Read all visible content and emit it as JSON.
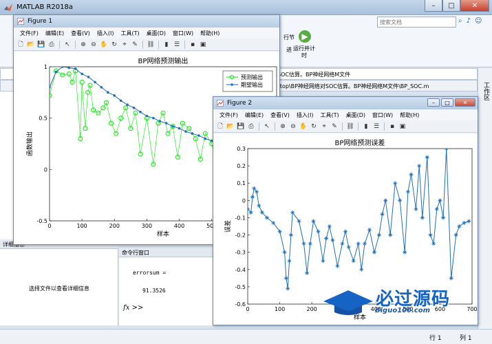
{
  "main": {
    "title": "MATLAB R2018a",
    "search_placeholder": "搜索文档",
    "ribbon_btn1": "行节",
    "ribbon_btn2": "进",
    "ribbon_run": "运行并计时",
    "path": "SOC估算。BP神经网络M文件",
    "editor_path": "sktop\\BP神经网络对SOC估算。BP神经网络M文件\\BP_SOC.m",
    "side_label": "工作区",
    "detail_header": "详细信息",
    "detail_msg": "选择文件以查看详细信息",
    "cmd_header": "命令行窗口",
    "cmd_line1": "errorsum =",
    "cmd_line2": "91.3526",
    "cmd_prompt": "fx >>",
    "status_row_label": "行",
    "status_row": "1",
    "status_col_label": "列",
    "status_col": "1",
    "accent": "#1f63b7"
  },
  "menu": [
    "文件(F)",
    "编辑(E)",
    "查看(V)",
    "插入(I)",
    "工具(T)",
    "桌面(D)",
    "窗口(W)",
    "帮助(H)"
  ],
  "figure1": {
    "title": "Figure 1",
    "chart_data": {
      "type": "line",
      "title": "BP网络预测输出",
      "xlabel": "样本",
      "ylabel": "函数输出",
      "xlim": [
        0,
        700
      ],
      "ylim": [
        -0.5,
        1
      ],
      "xticks": [
        0,
        100,
        200,
        300,
        400,
        500,
        600
      ],
      "yticks": [
        -0.5,
        0,
        0.5,
        1
      ],
      "legend": "top-right",
      "series": [
        {
          "name": "预测输出",
          "color": "#00ee00",
          "marker": "circle",
          "x": [
            0,
            20,
            40,
            60,
            70,
            80,
            95,
            100,
            110,
            118,
            125,
            135,
            150,
            165,
            175,
            190,
            205,
            220,
            235,
            250,
            265,
            280,
            300,
            320,
            335,
            350,
            365,
            380,
            395,
            410,
            430,
            450,
            465,
            480,
            500,
            515,
            530,
            550,
            565,
            580,
            600,
            620,
            640,
            660
          ],
          "y": [
            0.72,
            0.96,
            0.92,
            0.93,
            0.85,
            0.96,
            0.3,
            0.85,
            0.4,
            0.75,
            0.82,
            0.58,
            0.55,
            0.6,
            0.65,
            0.45,
            0.35,
            0.5,
            0.6,
            0.4,
            0.55,
            0.15,
            0.5,
            0.05,
            0.45,
            0.55,
            0.35,
            0.42,
            0.12,
            0.45,
            0.4,
            0.3,
            0.1,
            0.35,
            0.25,
            0.05,
            0.3,
            0.1,
            -0.05,
            0.2,
            0.05,
            0.25,
            0.1,
            0.2
          ]
        },
        {
          "name": "期望输出",
          "color": "#1f6fb8",
          "marker": "dot",
          "x": [
            0,
            20,
            40,
            60,
            80,
            100,
            120,
            140,
            160,
            180,
            200,
            220,
            240,
            260,
            280,
            300,
            320,
            340,
            360,
            380,
            400,
            420,
            440,
            460,
            480,
            500,
            520,
            540,
            560,
            580,
            600,
            620,
            640,
            660
          ],
          "y": [
            0.8,
            0.95,
            1.0,
            0.99,
            0.98,
            0.93,
            0.9,
            0.85,
            0.8,
            0.75,
            0.72,
            0.67,
            0.63,
            0.6,
            0.56,
            0.52,
            0.5,
            0.47,
            0.45,
            0.42,
            0.4,
            0.37,
            0.35,
            0.33,
            0.3,
            0.28,
            0.26,
            0.24,
            0.22,
            0.2,
            0.2,
            0.2,
            0.18,
            0.18
          ]
        }
      ]
    }
  },
  "figure2": {
    "title": "Figure 2",
    "chart_data": {
      "type": "line",
      "title": "BP网络预测误差",
      "xlabel": "样本",
      "ylabel": "误差",
      "xlim": [
        0,
        700
      ],
      "ylim": [
        -0.6,
        0.3
      ],
      "xticks": [
        0,
        100,
        200,
        300,
        400,
        500,
        600,
        700
      ],
      "yticks": [
        -0.6,
        -0.5,
        -0.4,
        -0.3,
        -0.2,
        -0.1,
        0,
        0.1,
        0.2,
        0.3
      ],
      "series": [
        {
          "color": "#1f6fb8",
          "marker": "star",
          "x": [
            0,
            10,
            15,
            20,
            28,
            35,
            45,
            60,
            80,
            100,
            115,
            120,
            125,
            130,
            135,
            140,
            160,
            175,
            185,
            195,
            205,
            220,
            235,
            245,
            255,
            265,
            280,
            295,
            305,
            315,
            330,
            345,
            355,
            365,
            380,
            395,
            410,
            420,
            430,
            445,
            460,
            475,
            490,
            500,
            510,
            525,
            535,
            545,
            560,
            570,
            580,
            590,
            600,
            610,
            620,
            635,
            650,
            660,
            675,
            690
          ],
          "y": [
            -0.05,
            -0.07,
            0.02,
            0.07,
            0.05,
            -0.03,
            -0.07,
            -0.1,
            -0.13,
            -0.18,
            -0.3,
            -0.45,
            -0.51,
            -0.35,
            -0.2,
            -0.07,
            -0.12,
            -0.25,
            -0.42,
            -0.25,
            -0.12,
            -0.18,
            -0.35,
            -0.22,
            -0.15,
            -0.23,
            -0.38,
            -0.25,
            -0.18,
            -0.27,
            -0.35,
            -0.25,
            -0.4,
            -0.25,
            -0.17,
            -0.3,
            -0.2,
            -0.08,
            0.0,
            -0.2,
            0.1,
            0.0,
            -0.3,
            0.05,
            0.15,
            -0.05,
            0.2,
            -0.1,
            0.25,
            -0.2,
            -0.25,
            -0.05,
            0.0,
            -0.1,
            0.3,
            -0.45,
            -0.2,
            -0.15,
            -0.13,
            -0.12
          ]
        }
      ]
    }
  },
  "watermark": {
    "text": "必过源码",
    "url": "Biguo100.com"
  }
}
